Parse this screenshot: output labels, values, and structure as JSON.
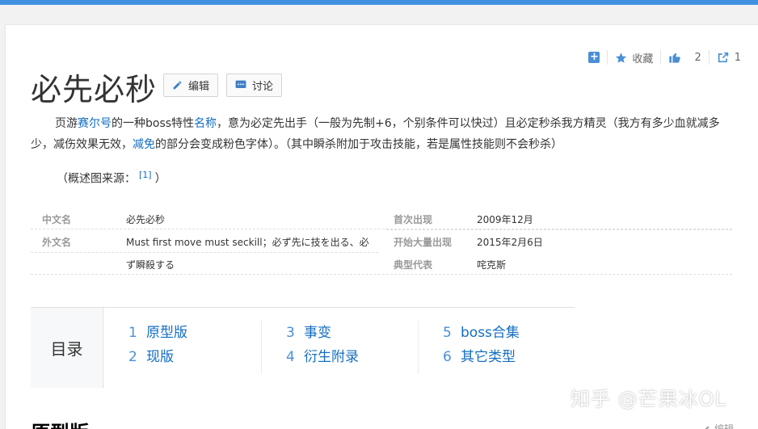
{
  "title": "必先必秒",
  "buttons": {
    "edit": "编辑",
    "discuss": "讨论"
  },
  "actions": {
    "add": "+",
    "favorite": "收藏",
    "like_count": "2",
    "share_count": "1"
  },
  "intro": {
    "p1": "页游",
    "link1": "赛尔号",
    "p2": "的一种boss特性",
    "link2": "名称",
    "p3": "，意为必定先出手（一般为先制+6，个别条件可以快过）且必定秒杀我方精灵（我方有多少血就减多少，减伤效果无效，",
    "link3": "减免",
    "p4": "的部分会变成粉色字体）。（其中瞬杀附加于攻击技能，若是属性技能则不会秒杀）"
  },
  "source": {
    "label": "（概述图来源：",
    "ref": "[1]",
    "close": "）"
  },
  "infobox": [
    {
      "k1": "中文名",
      "v1": "必先必秒",
      "k2": "首次出现",
      "v2": "2009年12月"
    },
    {
      "k1": "外文名",
      "v1": "Must first move must seckill；必ず先に技を出る、必",
      "k2": "开始大量出现",
      "v2": "2015年2月6日"
    },
    {
      "k1": "",
      "v1": "ず瞬殺する",
      "k2": "典型代表",
      "v2": "咤克斯"
    }
  ],
  "toc": {
    "title": "目录",
    "items": [
      {
        "num": "1",
        "label": "原型版"
      },
      {
        "num": "2",
        "label": "现版"
      },
      {
        "num": "3",
        "label": "事变"
      },
      {
        "num": "4",
        "label": "衍生附录"
      },
      {
        "num": "5",
        "label": "boss合集"
      },
      {
        "num": "6",
        "label": "其它类型"
      }
    ]
  },
  "section": {
    "title": "原型版",
    "edit": "编辑"
  },
  "watermark": "知乎 @芒果冰OL",
  "colors": {
    "accent": "#3f91e0",
    "link": "#136ec2",
    "icon": "#4a8fd6"
  }
}
